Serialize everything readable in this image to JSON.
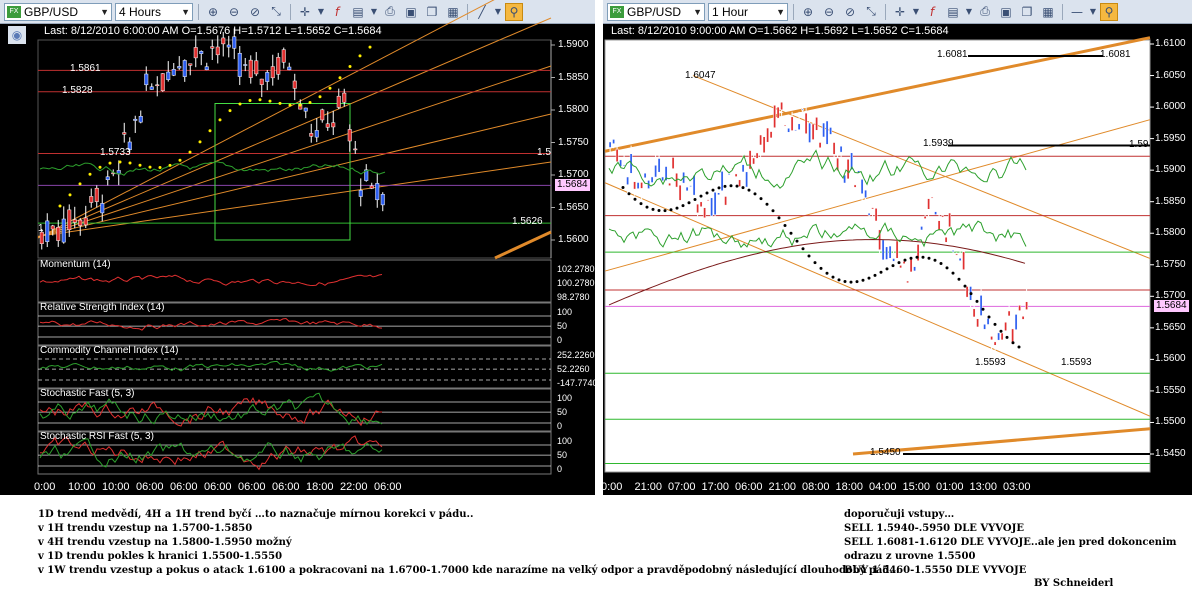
{
  "left": {
    "symbol": "GBP/USD",
    "timeframe": "4 Hours",
    "info": "Last: 8/12/2010 6:00:00 AM O=1.5676 H=1.5712 L=1.5652 C=1.5684",
    "price_ticks": [
      "1.5900",
      "1.5850",
      "1.5800",
      "1.5750",
      "1.5700",
      "1.5650",
      "1.5600"
    ],
    "current_price": "1.5684",
    "levels": [
      "1.5861",
      "1.5828",
      "1.5733",
      "1.5626"
    ],
    "level_side": "1.5",
    "left_edge_label": "1",
    "indicators": [
      {
        "name": "Momentum (14)",
        "ticks": [
          "102.2780",
          "100.2780",
          "98.2780"
        ]
      },
      {
        "name": "Relative Strength Index (14)",
        "ticks": [
          "100",
          "50",
          "0"
        ]
      },
      {
        "name": "Commodity Channel Index (14)",
        "ticks": [
          "252.2260",
          "52.2260",
          "-147.7740"
        ]
      },
      {
        "name": "Stochastic Fast (5, 3)",
        "ticks": [
          "100",
          "50",
          "0"
        ]
      },
      {
        "name": "Stochastic RSI Fast (5, 3)",
        "ticks": [
          "100",
          "50",
          "0"
        ]
      }
    ],
    "time_labels": [
      "0:00",
      "10:00",
      "10:00",
      "06:00",
      "06:00",
      "06:00",
      "06:00",
      "06:00",
      "18:00",
      "22:00",
      "06:00"
    ]
  },
  "right": {
    "symbol": "GBP/USD",
    "timeframe": "1 Hour",
    "info": "Last: 8/12/2010 9:00:00 AM O=1.5662 H=1.5692 L=1.5652 C=1.5684",
    "price_ticks": [
      "1.6100",
      "1.6050",
      "1.6000",
      "1.5950",
      "1.5900",
      "1.5850",
      "1.5800",
      "1.5750",
      "1.5700",
      "1.5650",
      "1.5600",
      "1.5550",
      "1.5500",
      "1.5450"
    ],
    "current_price": "1.5684",
    "levels": {
      "l6081a": "1.6081",
      "l6081b": "1.6081",
      "l6047": "1.6047",
      "l5939": "1.5939",
      "l59b": "1.59",
      "l5593a": "1.5593",
      "l5593b": "1.5593",
      "l5450": "1.5450"
    },
    "time_labels": [
      "0:00",
      "21:00",
      "07:00",
      "17:00",
      "06:00",
      "21:00",
      "08:00",
      "18:00",
      "04:00",
      "15:00",
      "01:00",
      "13:00",
      "03:00"
    ]
  },
  "notes_left": [
    "1D trend medvědí, 4H a 1H trend byčí …to naznačuje mírnou korekci v pádu..",
    "v 1H trendu vzestup na  1.5700-1.5850",
    "v 4H trendu vzestup na  1.5800-1.5950 možný",
    "v 1D trendu pokles k hranici  1.5500-1.5550",
    "v 1W trendu vzestup a pokus o atack  1.6100 a pokracovani na  1.6700-1.7000 kde narazíme na velký odpor a pravděpodobný následující dlouhodobý pád…"
  ],
  "notes_right": [
    "doporučuji vstupy…",
    "SELL 1.5940-.5950 DLE VYVOJE",
    "SELL 1.6081-1.6120 DLE VYVOJE..ale jen pred dokoncenim",
    "odrazu z urovne  1.5500",
    "BUY 1.5460-1.5550 DLE VYVOJE"
  ],
  "signature": "BY Schneiderl",
  "colors": {
    "up": "#2e5ff0",
    "down": "#e03030",
    "level_red": "#c03030",
    "level_green": "#2fb82f",
    "channel": "#e08a2a",
    "ma_green": "#2da02d"
  }
}
